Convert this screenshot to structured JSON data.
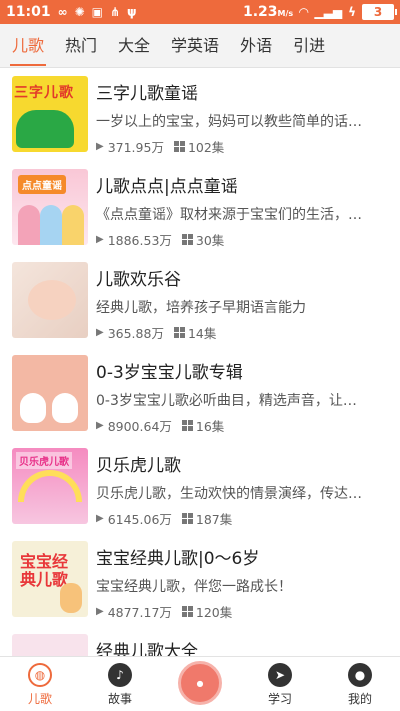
{
  "status_bar": {
    "time": "11:01",
    "speed": "1.23",
    "speed_unit": "M/s",
    "battery": "3"
  },
  "tabs": [
    {
      "label": "儿歌",
      "active": true
    },
    {
      "label": "热门",
      "active": false
    },
    {
      "label": "大全",
      "active": false
    },
    {
      "label": "学英语",
      "active": false
    },
    {
      "label": "外语",
      "active": false
    },
    {
      "label": "引进",
      "active": false
    }
  ],
  "items": [
    {
      "title": "三字儿歌童谣",
      "desc": "一岁以上的宝宝，妈妈可以教些简单的话…",
      "plays": "371.95万",
      "episodes": "102集",
      "thumb_text": "三字儿歌"
    },
    {
      "title": "儿歌点点|点点童谣",
      "desc": "《点点童谣》取材来源于宝宝们的生活，…",
      "plays": "1886.53万",
      "episodes": "30集",
      "thumb_text": "点点童谣"
    },
    {
      "title": "儿歌欢乐谷",
      "desc": "经典儿歌，培养孩子早期语言能力",
      "plays": "365.88万",
      "episodes": "14集",
      "thumb_text": ""
    },
    {
      "title": "0-3岁宝宝儿歌专辑",
      "desc": "0-3岁宝宝儿歌必听曲目，精选声音，让…",
      "plays": "8900.64万",
      "episodes": "16集",
      "thumb_text": ""
    },
    {
      "title": "贝乐虎儿歌",
      "desc": "贝乐虎儿歌，生动欢快的情景演绎，传达…",
      "plays": "6145.06万",
      "episodes": "187集",
      "thumb_text": "贝乐虎儿歌"
    },
    {
      "title": "宝宝经典儿歌|0～6岁",
      "desc": "宝宝经典儿歌，伴您一路成长！",
      "plays": "4877.17万",
      "episodes": "120集",
      "thumb_text": "宝宝经典儿歌"
    },
    {
      "title": "经典儿歌大全",
      "desc": "",
      "plays": "",
      "episodes": "",
      "thumb_text": ""
    }
  ],
  "bottom_nav": [
    {
      "label": "儿歌",
      "icon": "globe-icon",
      "active": true
    },
    {
      "label": "故事",
      "icon": "music-note-icon",
      "active": false
    },
    {
      "label": "",
      "icon": "record-button-icon",
      "active": false
    },
    {
      "label": "学习",
      "icon": "compass-icon",
      "active": false
    },
    {
      "label": "我的",
      "icon": "user-icon",
      "active": false
    }
  ],
  "colors": {
    "accent": "#ee6a3c",
    "tab_bar_bg": "#f3f3f3"
  }
}
